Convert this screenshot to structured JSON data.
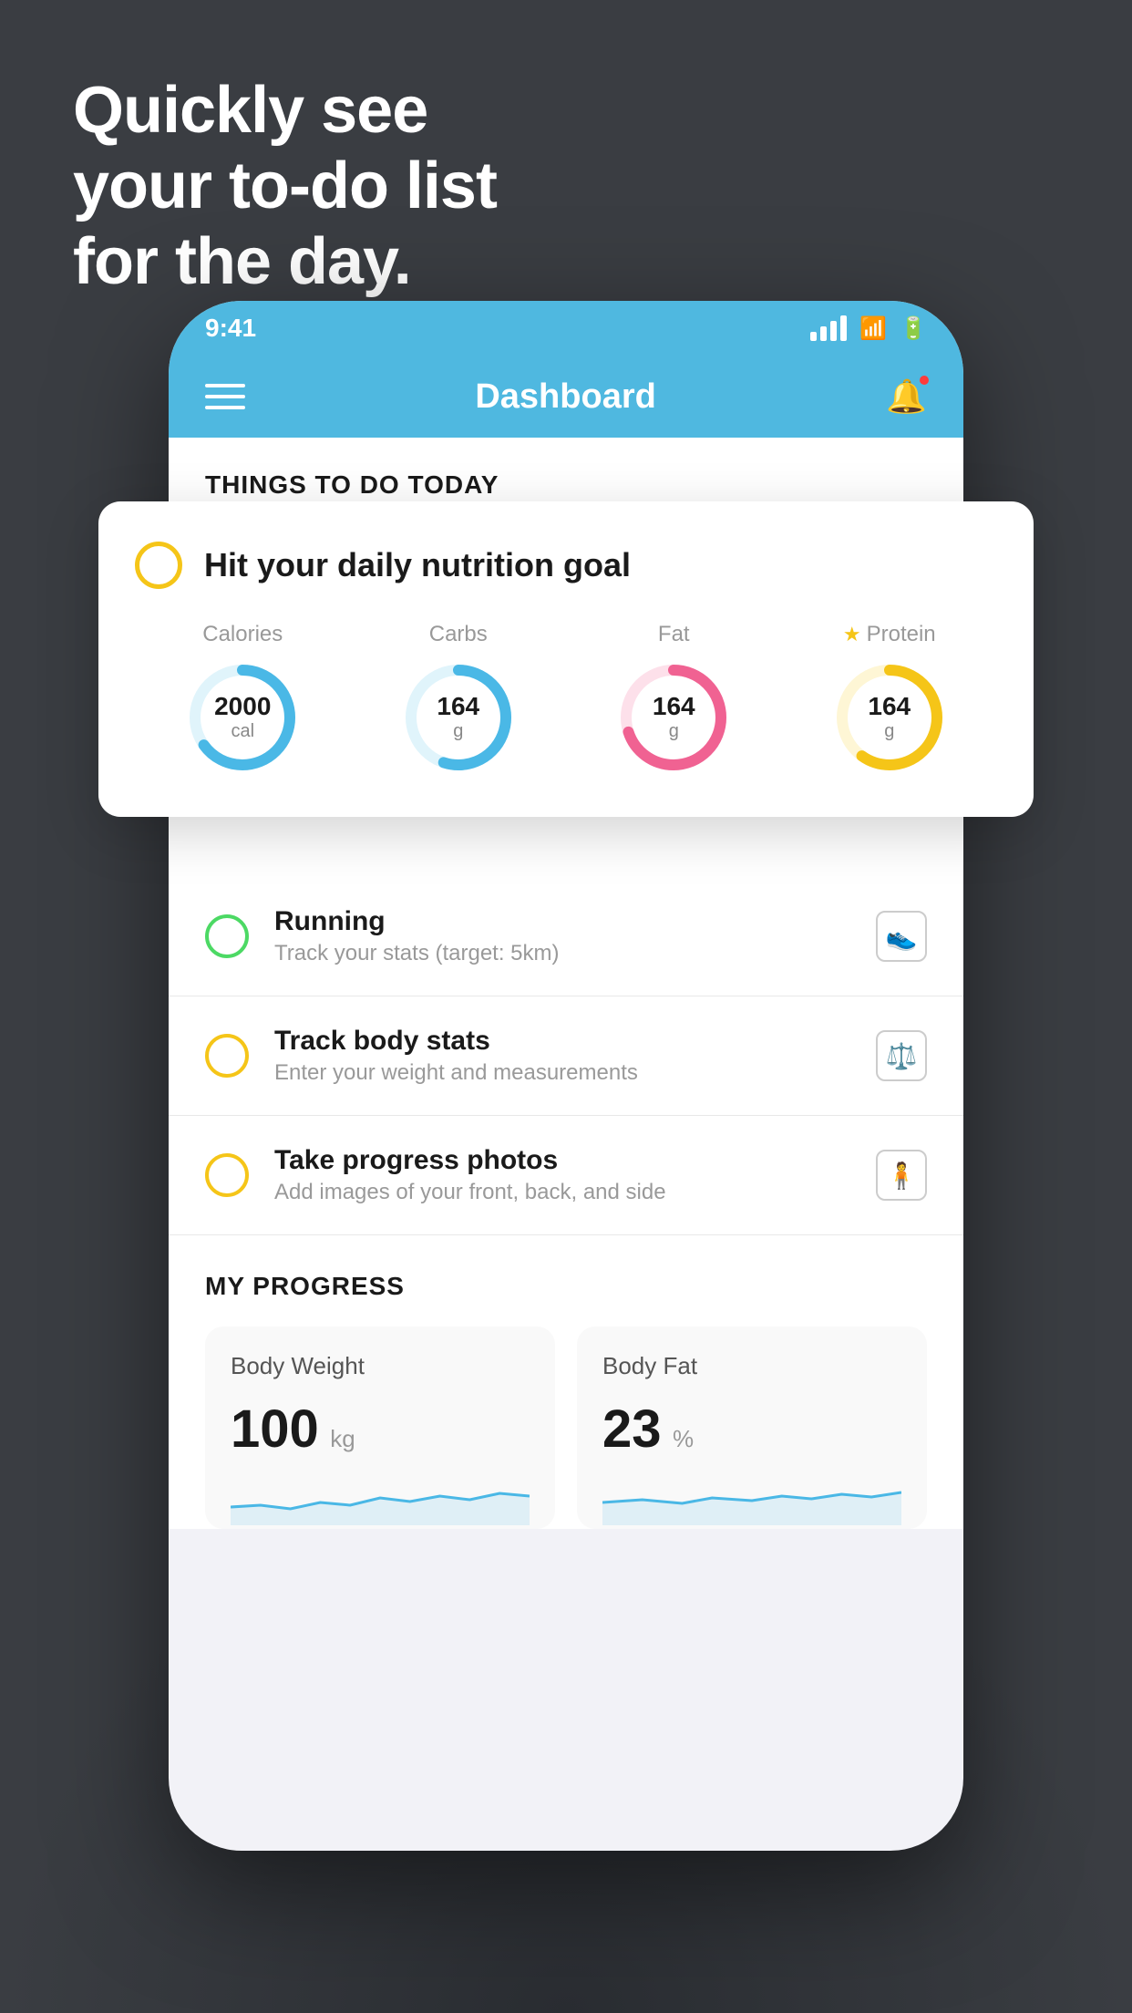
{
  "hero": {
    "line1": "Quickly see",
    "line2": "your to-do list",
    "line3": "for the day."
  },
  "status_bar": {
    "time": "9:41"
  },
  "nav": {
    "title": "Dashboard"
  },
  "things_section": {
    "header": "THINGS TO DO TODAY"
  },
  "floating_card": {
    "title": "Hit your daily nutrition goal",
    "nutrition": [
      {
        "label": "Calories",
        "value": "2000",
        "unit": "cal",
        "color": "#4ab8e6",
        "pct": 65,
        "star": false
      },
      {
        "label": "Carbs",
        "value": "164",
        "unit": "g",
        "color": "#4ab8e6",
        "pct": 55,
        "star": false
      },
      {
        "label": "Fat",
        "value": "164",
        "unit": "g",
        "color": "#f06292",
        "pct": 70,
        "star": false
      },
      {
        "label": "Protein",
        "value": "164",
        "unit": "g",
        "color": "#f5c518",
        "pct": 60,
        "star": true
      }
    ]
  },
  "todo_items": [
    {
      "type": "green",
      "title": "Running",
      "subtitle": "Track your stats (target: 5km)",
      "icon": "shoe"
    },
    {
      "type": "yellow",
      "title": "Track body stats",
      "subtitle": "Enter your weight and measurements",
      "icon": "scale"
    },
    {
      "type": "yellow",
      "title": "Take progress photos",
      "subtitle": "Add images of your front, back, and side",
      "icon": "person"
    }
  ],
  "progress": {
    "header": "MY PROGRESS",
    "cards": [
      {
        "title": "Body Weight",
        "value": "100",
        "unit": "kg"
      },
      {
        "title": "Body Fat",
        "value": "23",
        "unit": "%"
      }
    ]
  }
}
